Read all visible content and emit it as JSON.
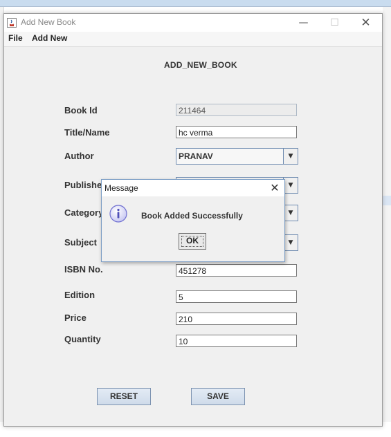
{
  "window": {
    "title": "Add New Book",
    "controls": {
      "minimize": "—",
      "maximize": "☐",
      "close": "✕"
    }
  },
  "menubar": {
    "file": "File",
    "add_new": "Add New"
  },
  "form": {
    "heading": "ADD_NEW_BOOK",
    "labels": {
      "book_id": "Book Id",
      "title": "Title/Name",
      "author": "Author",
      "publisher": "Publisher",
      "category": "Category",
      "subject": "Subject",
      "isbn": "ISBN No.",
      "edition": "Edition",
      "price": "Price",
      "quantity": "Quantity"
    },
    "values": {
      "book_id": "211464",
      "title": "hc verma",
      "author": "PRANAV",
      "isbn": "451278",
      "edition": "5",
      "price": "210",
      "quantity": "10"
    },
    "buttons": {
      "reset": "RESET",
      "save": "SAVE"
    }
  },
  "dialog": {
    "title": "Message",
    "message": "Book Added Successfully",
    "ok": "OK",
    "icon": "info-icon"
  },
  "colors": {
    "window_bg": "#f0f0f0",
    "accent_border": "#6e8bb0",
    "info_icon": "#6f6fd0"
  }
}
